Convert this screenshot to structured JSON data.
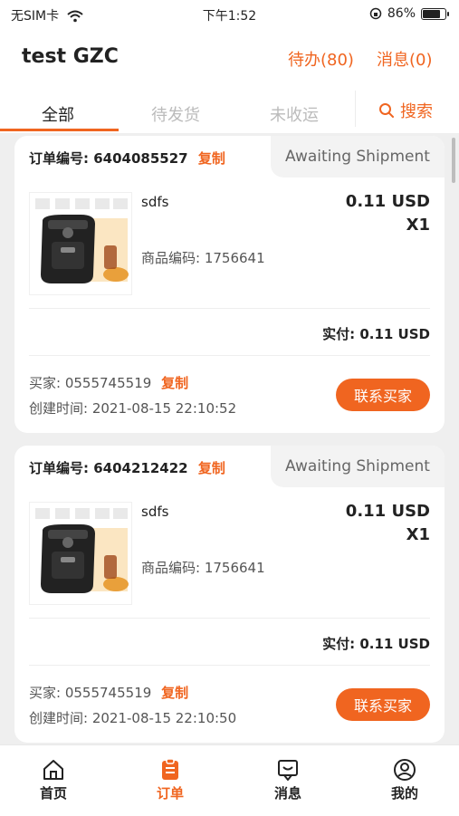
{
  "status_bar": {
    "carrier": "无SIM卡",
    "time": "下午1:52",
    "battery": "86%"
  },
  "header": {
    "title": "test GZC",
    "todo": "待办(80)",
    "messages": "消息(0)"
  },
  "tabs": {
    "items": [
      "全部",
      "待发货",
      "未收运"
    ],
    "active": 0,
    "search": "搜索"
  },
  "orders": [
    {
      "order_label": "订单编号:",
      "order_no": "6404085527",
      "copy": "复制",
      "status": "Awaiting Shipment",
      "product_name": "sdfs",
      "product_code": "商品编码:  1756641",
      "price": "0.11 USD",
      "qty": "X1",
      "paid_label": "实付:",
      "paid_value": "0.11 USD",
      "buyer_label": "买家:",
      "buyer_value": "0555745519",
      "created": "创建时间:  2021-08-15 22:10:52",
      "contact": "联系买家"
    },
    {
      "order_label": "订单编号:",
      "order_no": "6404212422",
      "copy": "复制",
      "status": "Awaiting Shipment",
      "product_name": "sdfs",
      "product_code": "商品编码:  1756641",
      "price": "0.11 USD",
      "qty": "X1",
      "paid_label": "实付:",
      "paid_value": "0.11 USD",
      "buyer_label": "买家:",
      "buyer_value": "0555745519",
      "created": "创建时间:  2021-08-15 22:10:50",
      "contact": "联系买家"
    }
  ],
  "bottom_nav": {
    "items": [
      "首页",
      "订单",
      "消息",
      "我的"
    ],
    "active": 1
  },
  "colors": {
    "accent": "#f06520",
    "background": "#efefef"
  },
  "icons": [
    "wifi-icon",
    "lock-rotation-icon",
    "battery-icon",
    "search-icon",
    "home-icon",
    "order-icon",
    "message-icon",
    "profile-icon"
  ]
}
